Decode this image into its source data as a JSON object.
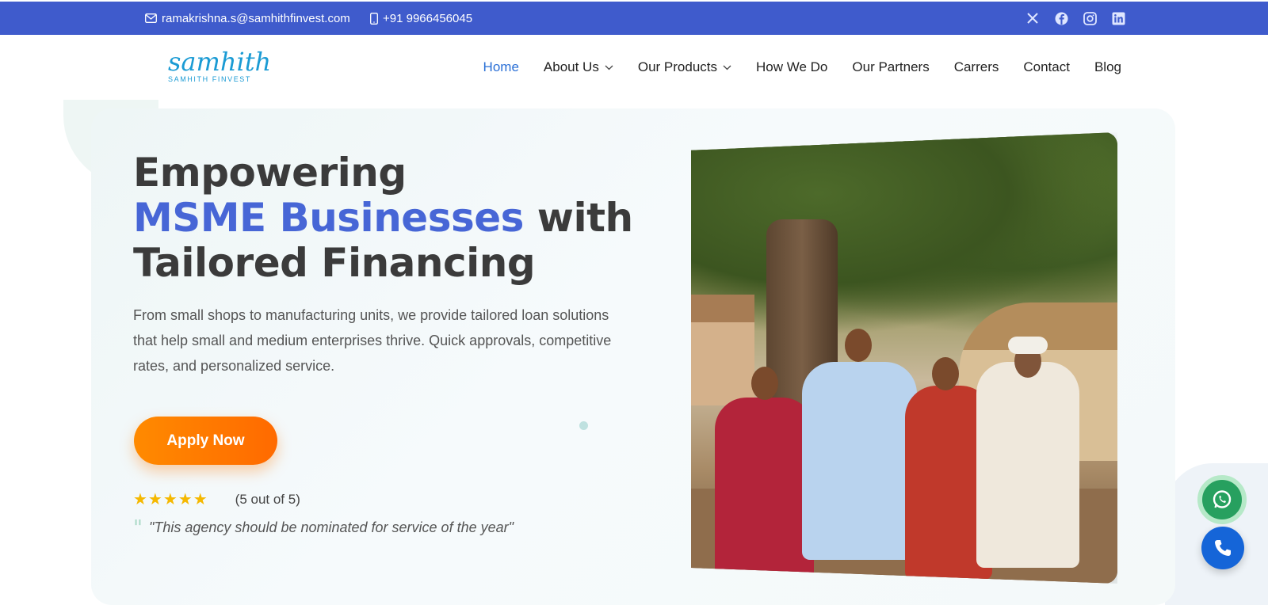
{
  "topbar": {
    "email": "ramakrishna.s@samhithfinvest.com",
    "phone": "+91 9966456045",
    "socials": [
      "x-icon",
      "facebook-icon",
      "instagram-icon",
      "linkedin-icon"
    ]
  },
  "brand": {
    "logo_word": "samhith",
    "logo_sub": "SAMHITH FINVEST"
  },
  "nav": {
    "items": [
      {
        "label": "Home",
        "active": true
      },
      {
        "label": "About Us",
        "dropdown": true
      },
      {
        "label": "Our Products",
        "dropdown": true
      },
      {
        "label": "How We Do"
      },
      {
        "label": "Our Partners"
      },
      {
        "label": "Carrers"
      },
      {
        "label": "Contact"
      },
      {
        "label": "Blog"
      }
    ]
  },
  "hero": {
    "line1": "Empowering",
    "accent": "MSME Businesses",
    "line2_rest": " with",
    "line3": "Tailored Financing",
    "description": "From small shops to manufacturing units, we provide tailored loan solutions that help small and medium enterprises thrive. Quick approvals, competitive rates, and personalized service.",
    "cta": "Apply Now",
    "stars": "★★★★★",
    "rating_text": "(5 out of 5)",
    "quote": "\"This agency should be nominated for service of the year\""
  },
  "colors": {
    "topbar": "#3f5bcc",
    "accent": "#4766d6",
    "cta": "#ff7a00",
    "active_nav": "#2a6fd6",
    "whatsapp": "#27a05f",
    "call": "#1565d8"
  }
}
